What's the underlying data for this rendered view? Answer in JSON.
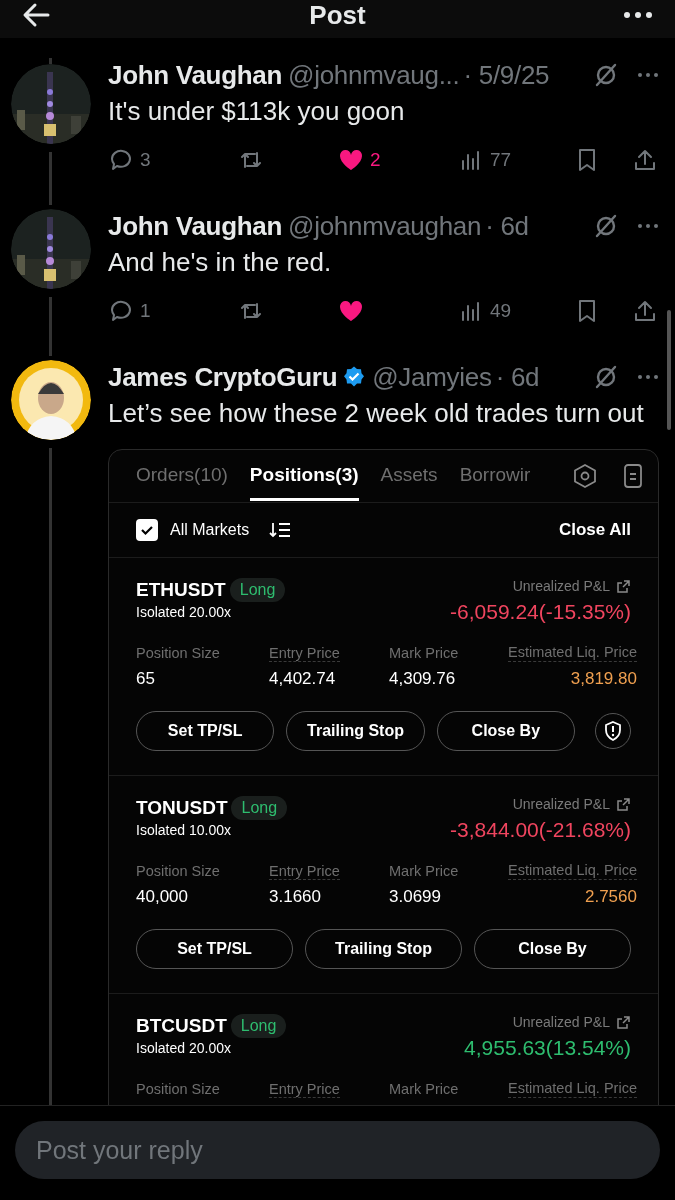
{
  "header": {
    "title": "Post"
  },
  "replies": [
    {
      "name": "John Vaughan",
      "handle": "@johnmvaug...",
      "time": "· 5/9/25",
      "text": "It's under $113k you goon",
      "actions": {
        "replies": "3",
        "liked": true,
        "likes": "2",
        "views": "77"
      }
    },
    {
      "name": "John Vaughan",
      "handle": "@johnmvaughan",
      "time": "· 6d",
      "text": "And he's in the red.",
      "actions": {
        "replies": "1",
        "liked": true,
        "views": "49"
      }
    },
    {
      "name": "James CryptoGuru",
      "verified": true,
      "handle": "@Jamyies",
      "time": "· 6d",
      "text": "Let’s see how these 2 week old trades turn out",
      "panel": {
        "tabs": [
          {
            "label": "Orders(10)",
            "selected": false
          },
          {
            "label": "Positions(3)",
            "selected": true
          },
          {
            "label": "Assets",
            "selected": false
          },
          {
            "label": "Borrowir",
            "selected": false
          }
        ],
        "filter": {
          "label": "All Markets",
          "checked": true
        },
        "close_all": "Close All",
        "positions": [
          {
            "symbol": "ETHUSDT",
            "side": "Long",
            "margin": "Isolated 20.00x",
            "pnl_label": "Unrealized P&L",
            "pnl": "-6,059.24(-15.35%)",
            "color": "#f0455f",
            "fields": [
              {
                "label": "Position Size",
                "value": "65"
              },
              {
                "label": "Entry Price",
                "value": "4,402.74"
              },
              {
                "label": "Mark Price",
                "value": "4,309.76"
              },
              {
                "label": "Estimated Liq. Price",
                "value": "3,819.80"
              }
            ],
            "buttons": [
              "Set TP/SL",
              "Trailing Stop",
              "Close By"
            ],
            "shield": true
          },
          {
            "symbol": "TONUSDT",
            "side": "Long",
            "margin": "Isolated 10.00x",
            "pnl_label": "Unrealized P&L",
            "pnl": "-3,844.00(-21.68%)",
            "color": "#f0455f",
            "fields": [
              {
                "label": "Position Size",
                "value": "40,000"
              },
              {
                "label": "Entry Price",
                "value": "3.1660"
              },
              {
                "label": "Mark Price",
                "value": "3.0699"
              },
              {
                "label": "Estimated Liq. Price",
                "value": "2.7560"
              }
            ],
            "buttons": [
              "Set TP/SL",
              "Trailing Stop",
              "Close By"
            ]
          },
          {
            "symbol": "BTCUSDT",
            "side": "Long",
            "margin": "Isolated 20.00x",
            "pnl_label": "Unrealized P&L",
            "pnl": "4,955.63(13.54%)",
            "color": "#2ebd6f",
            "fields": [
              {
                "label": "Position Size"
              },
              {
                "label": "Entry Price"
              },
              {
                "label": "Mark Price"
              },
              {
                "label": "Estimated Liq. Price"
              }
            ]
          }
        ]
      }
    }
  ],
  "reply_box": {
    "placeholder": "Post your reply"
  }
}
